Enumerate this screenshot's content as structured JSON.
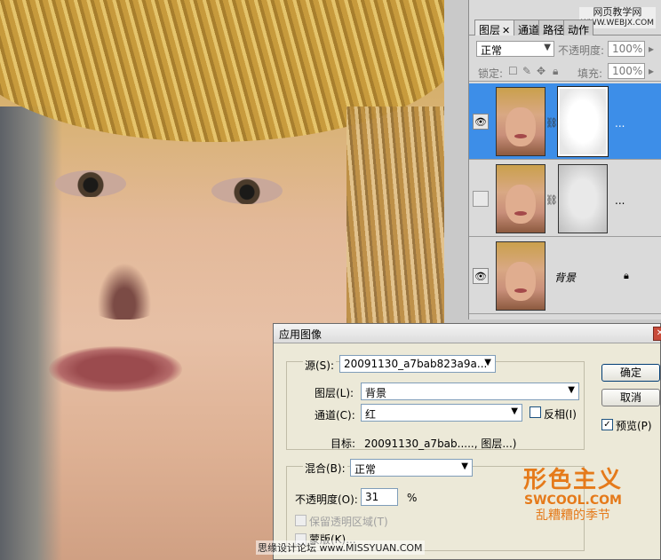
{
  "panel": {
    "tabs": [
      "图层",
      "通道",
      "路径",
      "动作"
    ],
    "site_watermark": {
      "line1": "网页教学网",
      "line2": "WWW.WEBJX.COM"
    },
    "blend_mode": "正常",
    "opacity_label": "不透明度:",
    "opacity_value": "100%",
    "lock_label": "锁定:",
    "fill_label": "填充:",
    "fill_value": "100%",
    "layers": [
      {
        "visible": true,
        "selected": true,
        "has_mask": true,
        "ellipsis": "..."
      },
      {
        "visible": false,
        "selected": false,
        "has_mask": true,
        "ellipsis": "..."
      },
      {
        "visible": true,
        "selected": false,
        "name": "背景",
        "locked": true
      }
    ]
  },
  "dialog": {
    "title": "应用图像",
    "source_label": "源(S):",
    "source_value": "20091130_a7bab823a9a...",
    "layer_label": "图层(L):",
    "layer_value": "背景",
    "channel_label": "通道(C):",
    "channel_value": "红",
    "invert_label": "反相(I)",
    "target_label": "目标:",
    "target_value": "20091130_a7bab....., 图层...)",
    "blend_label": "混合(B):",
    "blend_value": "正常",
    "opacity_label": "不透明度(O):",
    "opacity_value": "31",
    "opacity_unit": "%",
    "preserve_label": "保留透明区域(T)",
    "mask_label": "蒙版(K)...",
    "ok_label": "确定",
    "cancel_label": "取消",
    "preview_label": "预览(P)",
    "preview_checked": true
  },
  "watermarks": {
    "logo_main": "形色主义",
    "logo_url": "SWCOOL.COM",
    "logo_sub": "乱糟糟的季节",
    "credit": "思缘设计论坛 www.MISSYUAN.COM"
  }
}
